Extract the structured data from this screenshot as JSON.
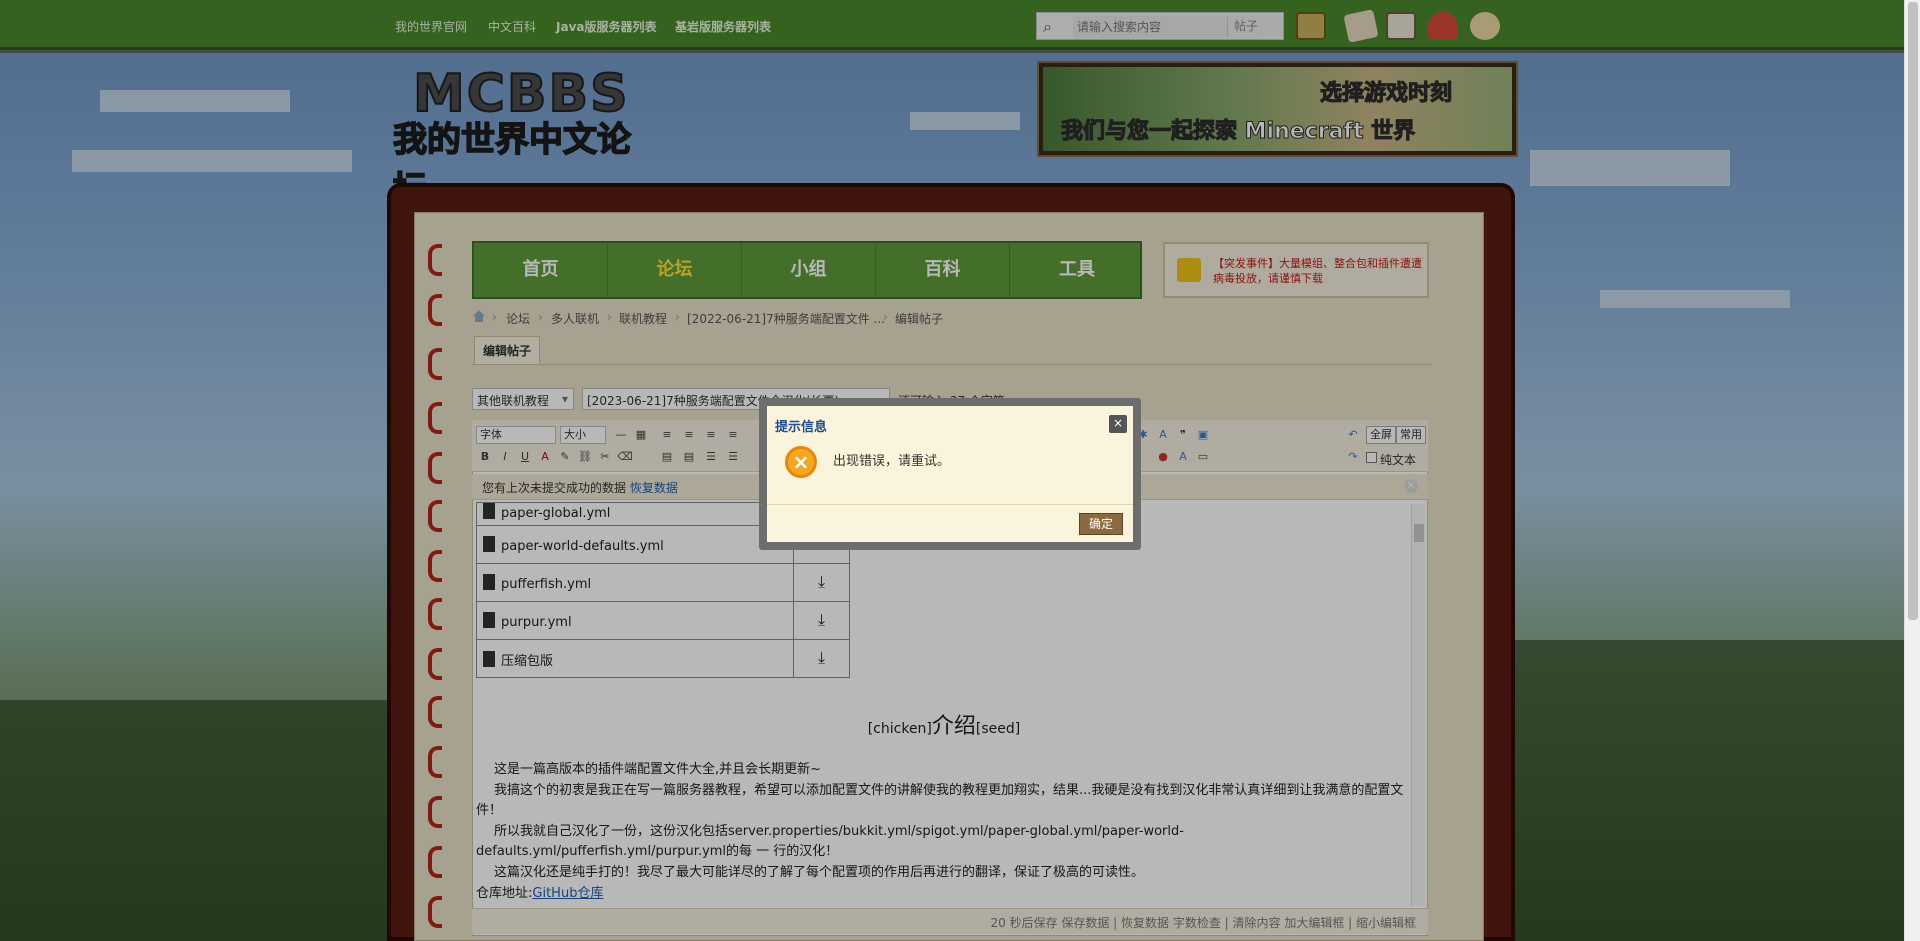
{
  "topnav": {
    "links": [
      "我的世界官网",
      "中文百科",
      "Java版服务器列表",
      "基岩版服务器列表"
    ],
    "search_placeholder": "请输入搜索内容",
    "search_scope": "帖子"
  },
  "brand": {
    "logo_title": "MCBBS",
    "logo_subtitle": "我的世界中文论坛",
    "banner_line1": "选择游戏时刻",
    "banner_line2": "我们与您一起探索 Minecraft 世界"
  },
  "mainnav": {
    "items": [
      "首页",
      "论坛",
      "小组",
      "百科",
      "工具"
    ],
    "active": "论坛"
  },
  "notice": {
    "text": "【突发事件】大量模组、整合包和插件遭遭病毒投放，请谨慎下载"
  },
  "breadcrumb": [
    "论坛",
    "多人联机",
    "联机教程",
    "[2022-06-21]7种服务端配置文件 ...",
    "编辑帖子"
  ],
  "tab": "编辑帖子",
  "form": {
    "category": "其他联机教程",
    "title": "[2023-06-21]7种服务端配置文件全汉化(长更)",
    "hint": "还可输入 37 个字符"
  },
  "toolbar": {
    "font": "字体",
    "size": "大小",
    "fullscreen": "全屏",
    "common": "常用",
    "plaintext": "纯文本",
    "bold": "B",
    "italic": "I",
    "underline": "U"
  },
  "restore": {
    "text": "您有上次未提交成功的数据",
    "link": "恢复数据"
  },
  "files": [
    "paper-global.yml",
    "paper-world-defaults.yml",
    "pufferfish.yml",
    "purpur.yml",
    "压缩包版"
  ],
  "intro": {
    "prefix": "[chicken]",
    "title": "介绍",
    "suffix": "[seed]"
  },
  "paragraphs": [
    "这是一篇高版本的插件端配置文件大全,并且会长期更新~",
    "我搞这个的初衷是我正在写一篇服务器教程，希望可以添加配置文件的讲解使我的教程更加翔实，结果...我硬是没有找到汉化非常认真详细到让我满意的配置文件！",
    "所以我就自己汉化了一份，这份汉化包括server.properties/bukkit.yml/spigot.yml/paper-global.yml/paper-world-defaults.yml/pufferfish.yml/purpur.yml的每 一 行的汉化！",
    "这篇汉化还是纯手打的！我尽了最大可能详尽的了解了每个配置项的作用后再进行的翻译，保证了极高的可读性。"
  ],
  "repo": {
    "label": "仓库地址:",
    "link": "GitHub仓库"
  },
  "status_bar": "20 秒后保存 保存数据 | 恢复数据    字数检查 | 清除内容    加大编辑框 | 缩小编辑框",
  "modal": {
    "title": "提示信息",
    "message": "出现错误，请重试。",
    "ok": "确定",
    "close": "×"
  }
}
